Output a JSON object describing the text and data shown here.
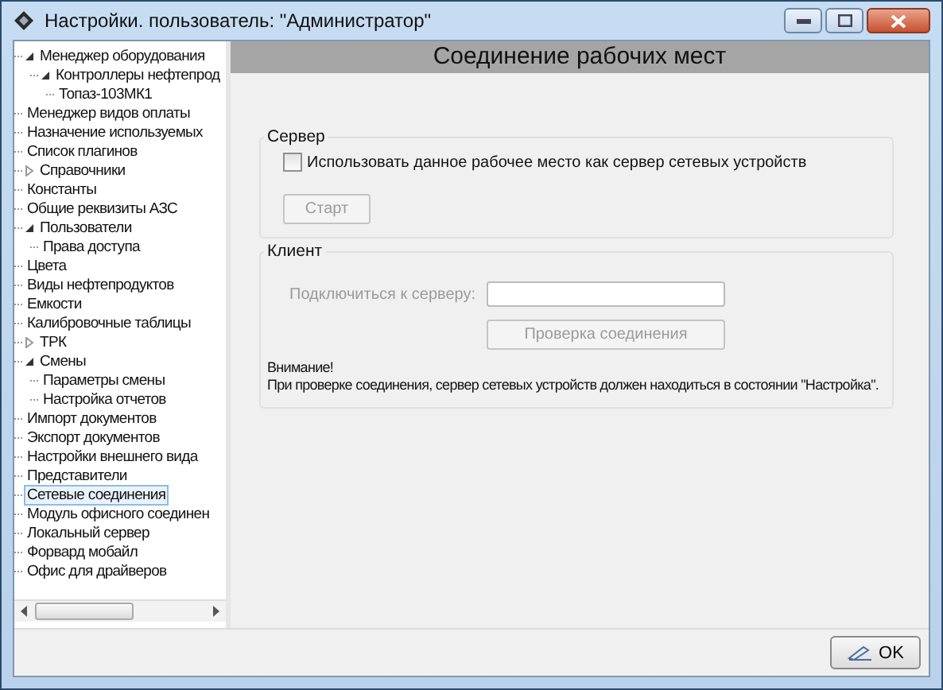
{
  "window": {
    "title": "Настройки. пользователь: \"Администратор\""
  },
  "tree": {
    "items": [
      {
        "label": "Менеджер оборудования",
        "expanded": true,
        "selected": false,
        "children": [
          {
            "label": "Контроллеры нефтепрод",
            "expanded": true,
            "selected": false,
            "children": [
              {
                "label": "Топаз-103МК1",
                "selected": false
              }
            ]
          }
        ]
      },
      {
        "label": "Менеджер видов оплаты",
        "selected": false
      },
      {
        "label": "Назначение используемых",
        "selected": false
      },
      {
        "label": "Список плагинов",
        "selected": false
      },
      {
        "label": "Справочники",
        "expanded": false,
        "selected": false
      },
      {
        "label": "Константы",
        "selected": false
      },
      {
        "label": "Общие реквизиты АЗС",
        "selected": false
      },
      {
        "label": "Пользователи",
        "expanded": true,
        "selected": false,
        "children": [
          {
            "label": "Права доступа",
            "selected": false
          }
        ]
      },
      {
        "label": "Цвета",
        "selected": false
      },
      {
        "label": "Виды нефтепродуктов",
        "selected": false
      },
      {
        "label": "Емкости",
        "selected": false
      },
      {
        "label": "Калибровочные таблицы",
        "selected": false
      },
      {
        "label": "ТРК",
        "expanded": false,
        "selected": false
      },
      {
        "label": "Смены",
        "expanded": true,
        "selected": false,
        "children": [
          {
            "label": "Параметры смены",
            "selected": false
          },
          {
            "label": "Настройка отчетов",
            "selected": false
          }
        ]
      },
      {
        "label": "Импорт документов",
        "selected": false
      },
      {
        "label": "Экспорт документов",
        "selected": false
      },
      {
        "label": "Настройки внешнего вида",
        "selected": false
      },
      {
        "label": "Представители",
        "selected": false
      },
      {
        "label": "Сетевые соединения",
        "selected": true
      },
      {
        "label": "Модуль офисного соединен",
        "selected": false
      },
      {
        "label": "Локальный сервер",
        "selected": false
      },
      {
        "label": "Форвард мобайл",
        "selected": false
      },
      {
        "label": "Офис для драйверов",
        "selected": false
      }
    ]
  },
  "page": {
    "heading": "Соединение рабочих мест",
    "server": {
      "title": "Сервер",
      "checkbox": {
        "label": "Использовать данное рабочее место как сервер сетевых устройств",
        "checked": false
      },
      "start_button": {
        "label": "Старт",
        "disabled": true
      }
    },
    "client": {
      "title": "Клиент",
      "connect_label": "Подключиться к серверу:",
      "connect_disabled": true,
      "check_button": {
        "label": "Проверка соединения",
        "disabled": true
      },
      "note": [
        "Внимание!",
        "При проверке соединения, сервер сетевых устройств должен находиться в состоянии \"Настройка\"."
      ]
    }
  },
  "ok_button": "OK"
}
